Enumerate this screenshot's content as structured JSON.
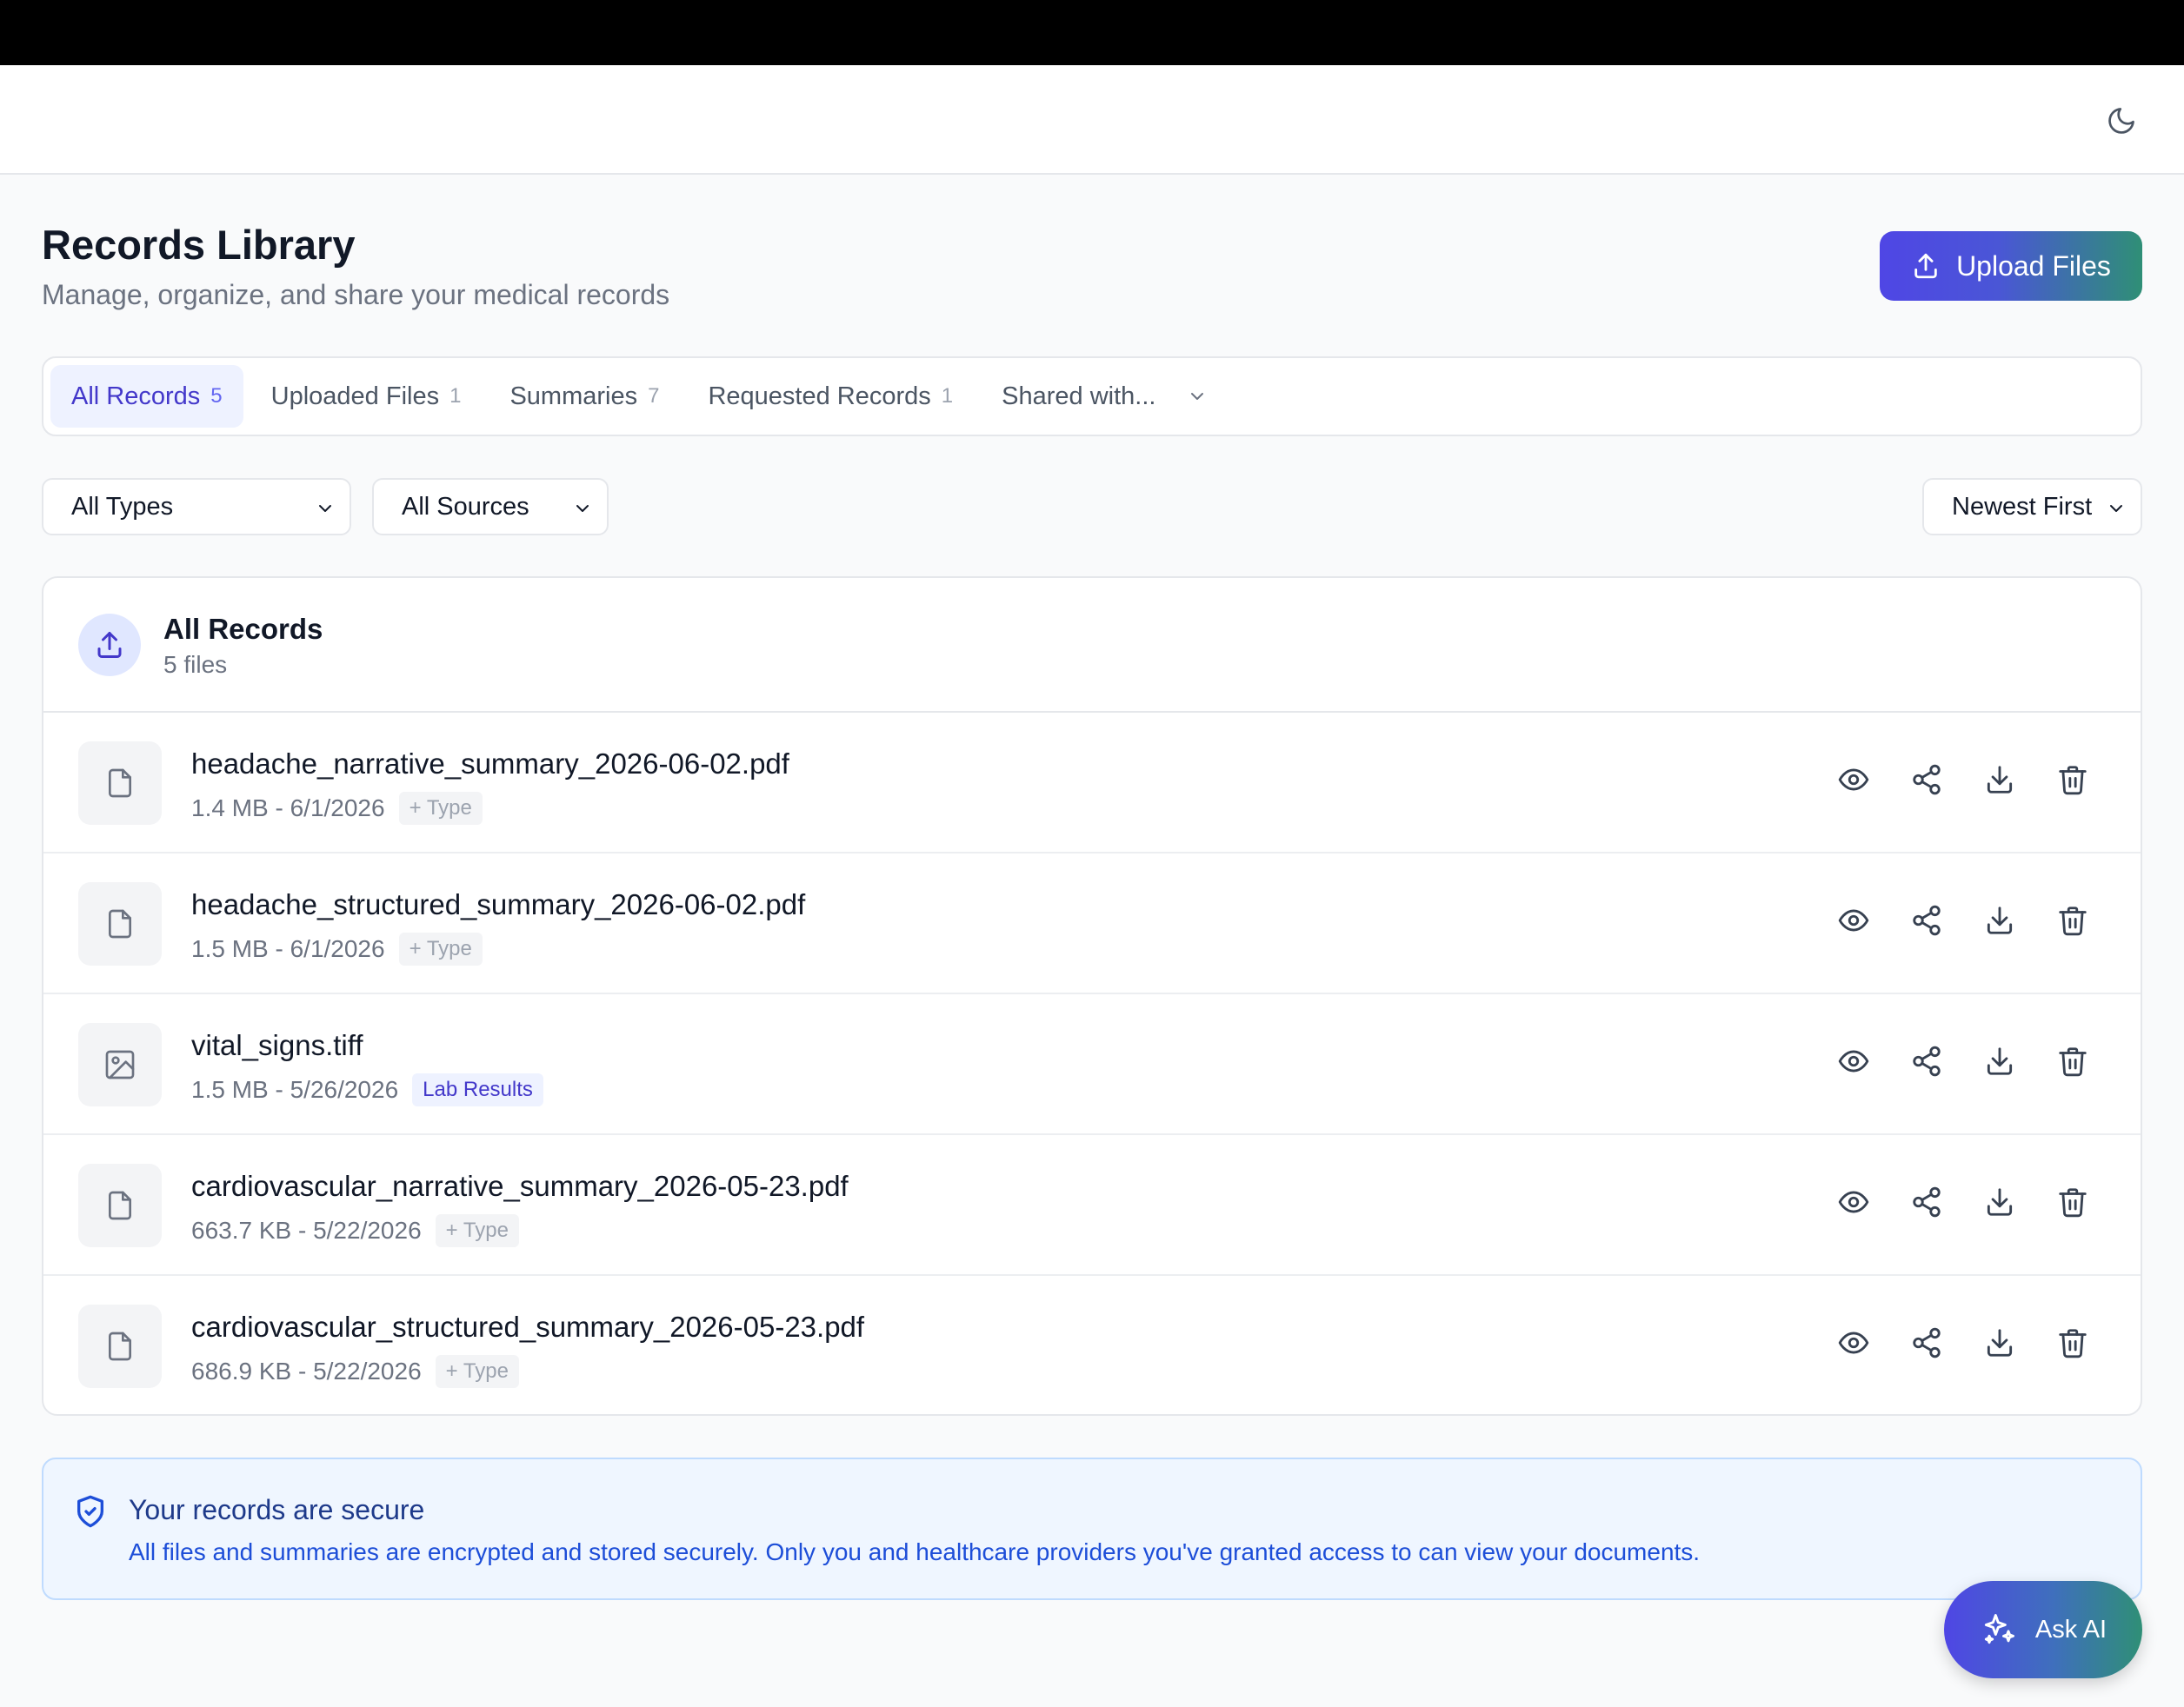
{
  "page": {
    "title": "Records Library",
    "subtitle": "Manage, organize, and share your medical records"
  },
  "header": {
    "theme_toggle_icon": "moon-icon"
  },
  "upload": {
    "label": "Upload Files",
    "icon": "upload-icon"
  },
  "tabs": [
    {
      "label": "All Records",
      "count": "5",
      "active": true
    },
    {
      "label": "Uploaded Files",
      "count": "1",
      "active": false
    },
    {
      "label": "Summaries",
      "count": "7",
      "active": false
    },
    {
      "label": "Requested Records",
      "count": "1",
      "active": false
    },
    {
      "label": "Shared with...",
      "count": "",
      "active": false
    }
  ],
  "filters": {
    "type": "All Types",
    "source": "All Sources",
    "sort": "Newest First"
  },
  "card": {
    "title": "All Records",
    "subtitle": "5 files"
  },
  "records": [
    {
      "name": "headache_narrative_summary_2026-06-02.pdf",
      "meta": "1.4 MB - 6/1/2026",
      "badge": "+ Type",
      "badge_kind": "type",
      "icon": "file-icon"
    },
    {
      "name": "headache_structured_summary_2026-06-02.pdf",
      "meta": "1.5 MB - 6/1/2026",
      "badge": "+ Type",
      "badge_kind": "type",
      "icon": "file-icon"
    },
    {
      "name": "vital_signs.tiff",
      "meta": "1.5 MB - 5/26/2026",
      "badge": "Lab Results",
      "badge_kind": "lab",
      "icon": "image-icon"
    },
    {
      "name": "cardiovascular_narrative_summary_2026-05-23.pdf",
      "meta": "663.7 KB - 5/22/2026",
      "badge": "+ Type",
      "badge_kind": "type",
      "icon": "file-icon"
    },
    {
      "name": "cardiovascular_structured_summary_2026-05-23.pdf",
      "meta": "686.9 KB - 5/22/2026",
      "badge": "+ Type",
      "badge_kind": "type",
      "icon": "file-icon"
    }
  ],
  "secure": {
    "title": "Your records are secure",
    "text": "All files and summaries are encrypted and stored securely. Only you and healthcare providers you've granted access to can view your documents."
  },
  "ask_ai": {
    "label": "Ask AI",
    "icon": "sparkles-icon"
  },
  "colors": {
    "accent": "#4f46e5",
    "accent_end": "#2f8f76",
    "info_bg": "#eff6ff"
  }
}
